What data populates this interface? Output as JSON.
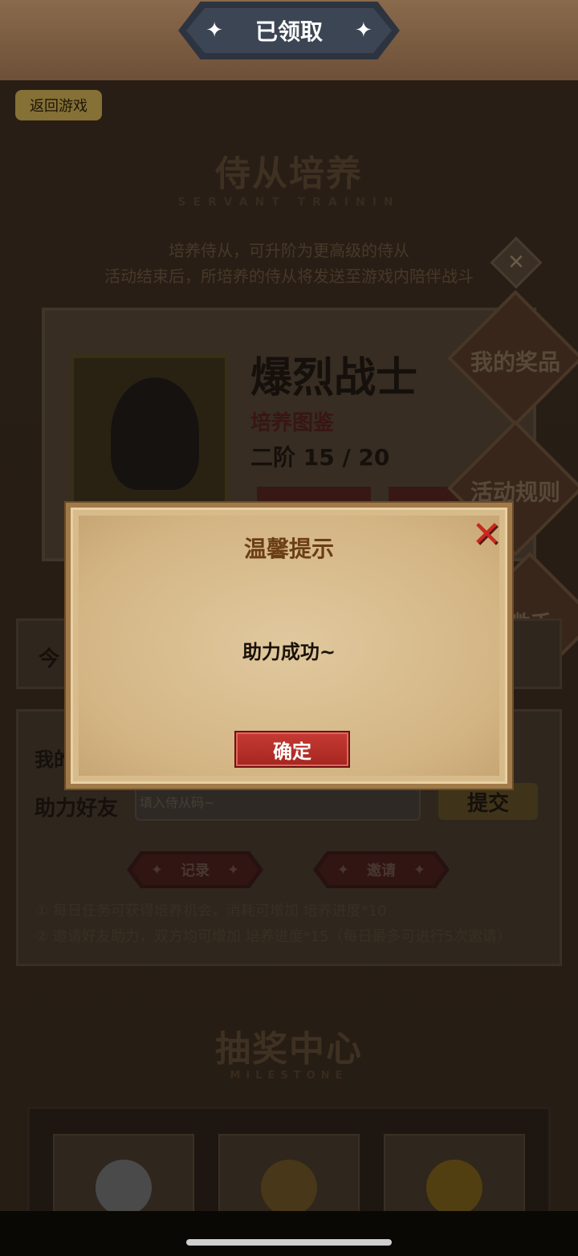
{
  "header": {
    "banner_label": "已领取",
    "back_label": "返回游戏"
  },
  "servant_section": {
    "title": "侍从培养",
    "subtitle": "SERVANT TRAININ",
    "desc_line1": "培养侍从，可升阶为更高级的侍从",
    "desc_line2": "活动结束后，所培养的侍从将发送至游戏内陪伴战斗",
    "close_glyph": "✕",
    "hero_name": "爆烈战士",
    "guide_label": "培养图鉴",
    "stage_label": "二阶 15 / 20"
  },
  "side_badges": {
    "prizes": "我的奖品",
    "rules": "活动规则",
    "assist": "微手"
  },
  "panels": {
    "today_label": "今",
    "mine_label": "我的",
    "assist_label": "助力好友",
    "assist_placeholder": "填入侍从码~",
    "submit_label": "提交",
    "record_label": "记录",
    "invite_label": "邀请",
    "rule1": "① 每日任务可获得培养机会，消耗可增加 培养进度*10",
    "rule2": "② 邀请好友助力，双方均可增加 培养进度*15（每日最多可进行5次邀请）"
  },
  "lottery_section": {
    "title": "抽奖中心",
    "subtitle": "MILESTONE"
  },
  "modal": {
    "title": "温馨提示",
    "close_glyph": "✕",
    "message": "助力成功~",
    "confirm_label": "确定"
  },
  "icons": {
    "star": "✦",
    "close": "✕"
  }
}
